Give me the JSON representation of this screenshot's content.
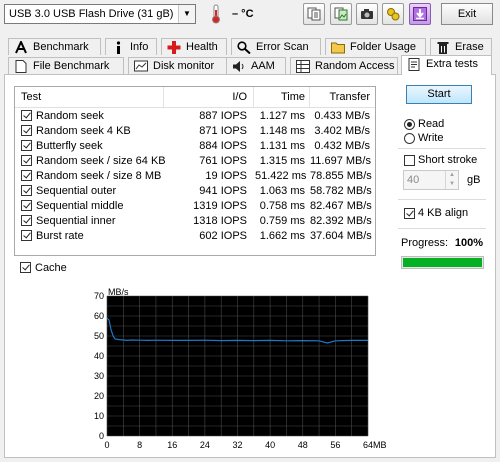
{
  "toolbar": {
    "drive": "USB 3.0 USB Flash Drive (31 gB)",
    "temperature": "– °C",
    "exit_label": "Exit",
    "icons": [
      "copy-text-icon",
      "copy-bitmap-icon",
      "camera-icon",
      "options-icon",
      "save-icon"
    ]
  },
  "tabs_row1": [
    "Benchmark",
    "Info",
    "Health",
    "Error Scan",
    "Folder Usage",
    "Erase"
  ],
  "tabs_row2": [
    "File Benchmark",
    "Disk monitor",
    "AAM",
    "Random Access",
    "Extra tests"
  ],
  "active_tab": "Extra tests",
  "table": {
    "headers": {
      "test": "Test",
      "io": "I/O",
      "time": "Time",
      "transfer": "Transfer"
    },
    "rows": [
      {
        "name": "Random seek",
        "io": "887 IOPS",
        "time": "1.127 ms",
        "transfer": "0.433 MB/s"
      },
      {
        "name": "Random seek 4 KB",
        "io": "871 IOPS",
        "time": "1.148 ms",
        "transfer": "3.402 MB/s"
      },
      {
        "name": "Butterfly seek",
        "io": "884 IOPS",
        "time": "1.131 ms",
        "transfer": "0.432 MB/s"
      },
      {
        "name": "Random seek / size 64 KB",
        "io": "761 IOPS",
        "time": "1.315 ms",
        "transfer": "11.697 MB/s"
      },
      {
        "name": "Random seek / size 8 MB",
        "io": "19 IOPS",
        "time": "51.422 ms",
        "transfer": "78.855 MB/s"
      },
      {
        "name": "Sequential outer",
        "io": "941 IOPS",
        "time": "1.063 ms",
        "transfer": "58.782 MB/s"
      },
      {
        "name": "Sequential middle",
        "io": "1319 IOPS",
        "time": "0.758 ms",
        "transfer": "82.467 MB/s"
      },
      {
        "name": "Sequential inner",
        "io": "1318 IOPS",
        "time": "0.759 ms",
        "transfer": "82.392 MB/s"
      },
      {
        "name": "Burst rate",
        "io": "602 IOPS",
        "time": "1.662 ms",
        "transfer": "37.604 MB/s"
      }
    ]
  },
  "cache_label": "Cache",
  "controls": {
    "start_label": "Start",
    "read_label": "Read",
    "write_label": "Write",
    "short_stroke_label": "Short stroke",
    "short_stroke_value": "40",
    "unit_label": "gB",
    "align_label": "4 KB align",
    "progress_label": "Progress:",
    "progress_value": "100%",
    "progress_fraction": 1.0,
    "progress_color": "#06b025"
  },
  "chart_data": {
    "type": "line",
    "ylabel": "MB/s",
    "xunit": "MB",
    "ylim": [
      0,
      70
    ],
    "xlim": [
      0,
      64
    ],
    "yticks": [
      "70",
      "60",
      "50",
      "40",
      "30",
      "20",
      "10",
      "0"
    ],
    "xticks": [
      "0",
      "8",
      "16",
      "24",
      "32",
      "40",
      "48",
      "56",
      "64MB"
    ],
    "background": "#000000",
    "grid_color": "#4a4a4a",
    "line_color": "#1e78c8",
    "series": [
      {
        "x": [
          0,
          0.5,
          1,
          1.5,
          2,
          3,
          4,
          5,
          6,
          8,
          10,
          12,
          16,
          20,
          24,
          28,
          32,
          36,
          40,
          44,
          48,
          52,
          54,
          56,
          60,
          64
        ],
        "y": [
          59,
          58,
          53,
          50,
          48.5,
          48.2,
          48,
          47.8,
          48,
          47.9,
          47.8,
          47.9,
          47.8,
          47.8,
          47.9,
          47.7,
          47.8,
          47.7,
          47.8,
          47.6,
          47.7,
          47.6,
          46.5,
          47.6,
          47.8,
          47.8
        ]
      }
    ]
  }
}
